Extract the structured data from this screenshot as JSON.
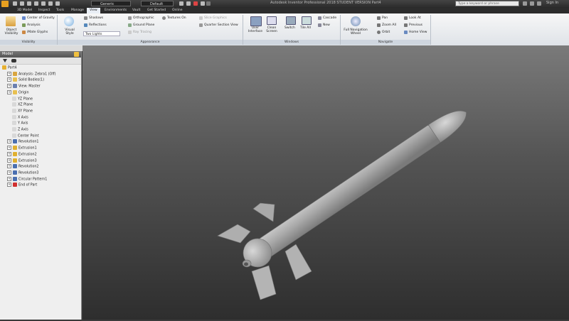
{
  "titlebar": {
    "material": "Generic",
    "appearance": "Default",
    "title": "Autodesk Inventor Professional 2018 STUDENT VERSION  Part4",
    "search_placeholder": "Type a keyword or phrase",
    "signin": "Sign In"
  },
  "tabs": [
    "3D Model",
    "Inspect",
    "Tools",
    "Manage",
    "View",
    "Environments",
    "Vault",
    "Get Started",
    "Online"
  ],
  "active_tab": "View",
  "ribbon": {
    "visibility": {
      "object_visibility": "Object Visibility",
      "center_of_gravity": "Center of Gravity",
      "analysis": "Analysis",
      "iMate_glyphs": "iMate Glyphs",
      "panel": "Visibility"
    },
    "appearance": {
      "visual_style": "Visual Style",
      "shadows": "Shadows",
      "reflections": "Reflections",
      "lighting": "Two Lights",
      "orthographic": "Orthographic",
      "ground_plane": "Ground Plane",
      "ray_tracing": "Ray Tracing",
      "textures_on": "Textures On",
      "slice_graphics": "Slice Graphics",
      "quarter_section": "Quarter Section View",
      "panel": "Appearance"
    },
    "windows": {
      "user_interface": "User Interface",
      "clean_screen": "Clean Screen",
      "switch": "Switch",
      "tile_all": "Tile All",
      "cascade": "Cascade",
      "new": "New",
      "panel": "Windows"
    },
    "navigate": {
      "full_nav_wheel": "Full Navigation Wheel",
      "pan": "Pan",
      "zoom_all": "Zoom All",
      "orbit": "Orbit",
      "look_at": "Look At",
      "previous": "Previous",
      "home_view": "Home View",
      "panel": "Navigate"
    }
  },
  "browser": {
    "title": "Model",
    "items": [
      {
        "label": "Part4",
        "indent": 0,
        "color": "#e6b030"
      },
      {
        "label": "Analysis: Zebra1 (Off)",
        "indent": 1,
        "color": "#d9a640"
      },
      {
        "label": "Solid Bodies(1)",
        "indent": 1,
        "color": "#e8c050"
      },
      {
        "label": "View: Master",
        "indent": 1,
        "color": "#6a7fb0"
      },
      {
        "label": "Origin",
        "indent": 1,
        "color": "#e8c050"
      },
      {
        "label": "YZ Plane",
        "indent": 2,
        "color": "#d8d8d8"
      },
      {
        "label": "XZ Plane",
        "indent": 2,
        "color": "#d8d8d8"
      },
      {
        "label": "XY Plane",
        "indent": 2,
        "color": "#d8d8d8"
      },
      {
        "label": "X Axis",
        "indent": 2,
        "color": "#d8d8d8"
      },
      {
        "label": "Y Axis",
        "indent": 2,
        "color": "#d8d8d8"
      },
      {
        "label": "Z Axis",
        "indent": 2,
        "color": "#d8d8d8"
      },
      {
        "label": "Center Point",
        "indent": 2,
        "color": "#d8d8d8"
      },
      {
        "label": "Revolution1",
        "indent": 1,
        "color": "#4a6fb0"
      },
      {
        "label": "Extrusion1",
        "indent": 1,
        "color": "#e0b030"
      },
      {
        "label": "Extrusion2",
        "indent": 1,
        "color": "#e0b030"
      },
      {
        "label": "Extrusion3",
        "indent": 1,
        "color": "#e0b030"
      },
      {
        "label": "Revolution2",
        "indent": 1,
        "color": "#4a6fb0"
      },
      {
        "label": "Revolution3",
        "indent": 1,
        "color": "#4a6fb0"
      },
      {
        "label": "Circular Pattern1",
        "indent": 1,
        "color": "#4a6fb0"
      },
      {
        "label": "End of Part",
        "indent": 1,
        "color": "#d03030"
      }
    ]
  }
}
